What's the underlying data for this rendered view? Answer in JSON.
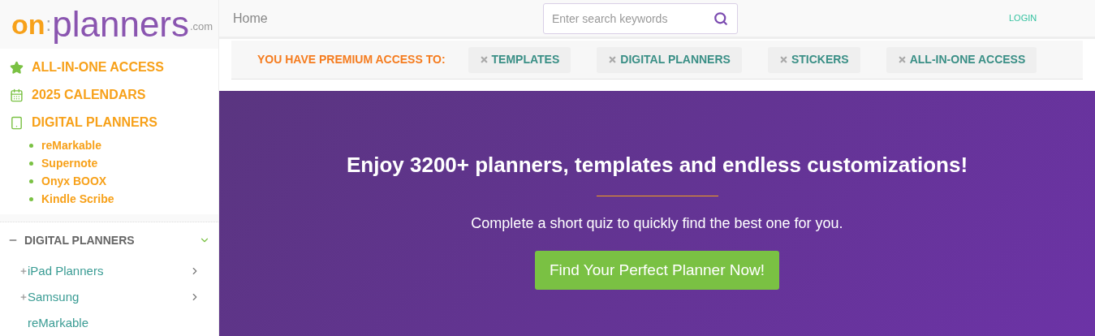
{
  "logo": {
    "on": "on",
    "separator": ":",
    "name": "planners",
    "suffix": ".com"
  },
  "sidebar": {
    "links": [
      {
        "kind": "star",
        "label": "ALL-IN-ONE ACCESS"
      },
      {
        "kind": "calendar",
        "label": "2025 CALENDARS"
      },
      {
        "kind": "tablet",
        "label": "DIGITAL PLANNERS",
        "sublinks": [
          "reMarkable",
          "Supernote",
          "Onyx BOOX",
          "Kindle Scribe"
        ]
      }
    ],
    "section": {
      "title": "DIGITAL PLANNERS",
      "expanded": true,
      "items": [
        {
          "label": "iPad Planners",
          "kind": "group"
        },
        {
          "label": "Samsung",
          "kind": "group"
        },
        {
          "label": "reMarkable",
          "kind": "link"
        }
      ]
    }
  },
  "header": {
    "breadcrumb": "Home",
    "search": {
      "placeholder": "Enter search keywords"
    },
    "login": "LOGIN"
  },
  "premium": {
    "label": "YOU HAVE PREMIUM ACCESS TO:",
    "tags": [
      "TEMPLATES",
      "DIGITAL PLANNERS",
      "STICKERS",
      "ALL-IN-ONE ACCESS"
    ]
  },
  "hero": {
    "title": "Enjoy 3200+ planners, templates and endless customizations!",
    "subtitle": "Complete a short quiz to quickly find the best one for you.",
    "button": "Find Your Perfect Planner Now!"
  }
}
